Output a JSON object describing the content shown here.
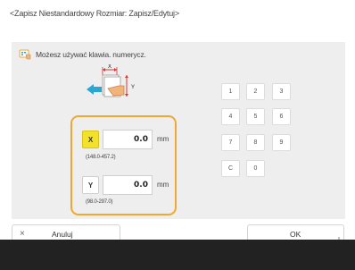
{
  "header": {
    "title": "<Zapisz Niestandardowy Rozmiar: Zapisz/Edytuj>"
  },
  "hint": {
    "text": "Możesz używać klawia. numerycz."
  },
  "diagram": {
    "x_label": "X",
    "y_label": "Y"
  },
  "fields": {
    "x": {
      "axis_label": "X",
      "value": "0.0",
      "unit": "mm",
      "range": "(148.0-457.2)"
    },
    "y": {
      "axis_label": "Y",
      "value": "0.0",
      "unit": "mm",
      "range": "(98.0-297.0)"
    }
  },
  "numpad": {
    "keys": [
      "1",
      "2",
      "3",
      "4",
      "5",
      "6",
      "7",
      "8",
      "9",
      "C",
      "0"
    ]
  },
  "buttons": {
    "cancel_icon": "×",
    "cancel_label": "Anuluj",
    "ok_label": "OK"
  },
  "colors": {
    "accent": "#f0a830",
    "selected_axis": "#f4e22a",
    "arrow": "#2aa7d0"
  }
}
